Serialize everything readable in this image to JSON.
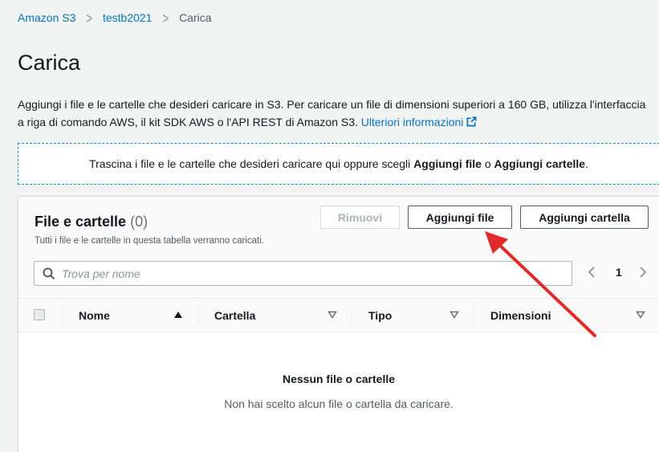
{
  "breadcrumb": {
    "items": [
      "Amazon S3",
      "testb2021"
    ],
    "current": "Carica"
  },
  "page": {
    "title": "Carica"
  },
  "description": {
    "line1": "Aggiungi i file e le cartelle che desideri caricare in S3. Per caricare un file di dimensioni superiori a 160 GB, utilizza l'interfaccia",
    "line2": "a riga di comando AWS, il kit SDK AWS o l'API REST di Amazon S3.",
    "link": "Ulteriori informazioni"
  },
  "dropzone": {
    "text_before": "Trascina i file e le cartelle che desideri caricare qui oppure scegli",
    "bold1": "Aggiungi file",
    "text_middle": "o",
    "bold2": "Aggiungi cartelle",
    "text_after": "."
  },
  "panel": {
    "title": "File e cartelle",
    "count": "(0)",
    "subtitle": "Tutti i file e le cartelle in questa tabella verranno caricati.",
    "buttons": {
      "remove": "Rimuovi",
      "add_file": "Aggiungi file",
      "add_folder": "Aggiungi cartella"
    },
    "search": {
      "placeholder": "Trova per nome",
      "value": ""
    },
    "pagination": {
      "page": "1"
    },
    "columns": [
      "Nome",
      "Cartella",
      "Tipo",
      "Dimensioni"
    ],
    "empty": {
      "title": "Nessun file o cartelle",
      "message": "Non hai scelto alcun file o cartella da caricare."
    }
  },
  "annotation": {
    "color": "#e02b2b"
  },
  "colors": {
    "link": "#0073bb",
    "dropzone_border": "#0a95b4",
    "text": "#16191f"
  }
}
